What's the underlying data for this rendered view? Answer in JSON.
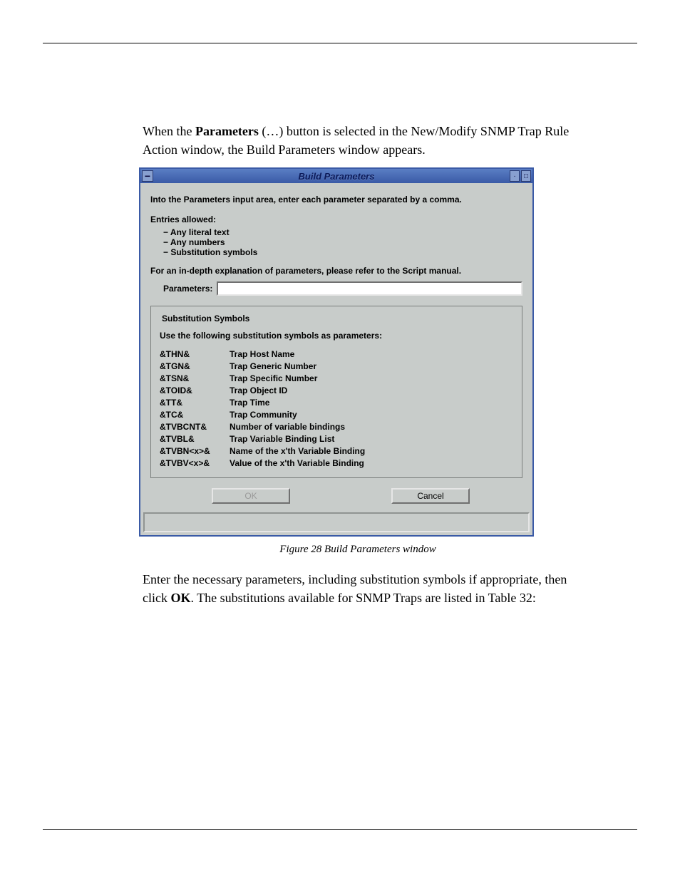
{
  "intro": {
    "prefix": "When the ",
    "boldWord": "Parameters",
    "suffix": " (…) button is selected in the New/Modify SNMP Trap Rule Action window, the Build Parameters window appears."
  },
  "window": {
    "title": "Build Parameters",
    "instruction": "Into the Parameters input area, enter each parameter separated by a comma.",
    "allowedHeader": "Entries allowed:",
    "allowed": [
      "Any literal text",
      "Any numbers",
      "Substitution symbols"
    ],
    "refText": "For an in-depth explanation of parameters, please refer to the Script manual.",
    "paramLabel": "Parameters:",
    "paramValue": "",
    "substitution": {
      "title": "Substitution Symbols",
      "intro": "Use the following substitution symbols as parameters:",
      "rows": [
        {
          "sym": "&THN&",
          "desc": "Trap Host Name"
        },
        {
          "sym": "&TGN&",
          "desc": "Trap Generic Number"
        },
        {
          "sym": "&TSN&",
          "desc": "Trap Specific Number"
        },
        {
          "sym": "&TOID&",
          "desc": "Trap Object ID"
        },
        {
          "sym": "&TT&",
          "desc": "Trap Time"
        },
        {
          "sym": "&TC&",
          "desc": "Trap Community"
        },
        {
          "sym": "&TVBCNT&",
          "desc": "Number of variable bindings"
        },
        {
          "sym": "&TVBL&",
          "desc": "Trap Variable Binding List"
        },
        {
          "sym": "&TVBN<x>&",
          "desc": "Name of the x'th Variable Binding"
        },
        {
          "sym": "&TVBV<x>&",
          "desc": "Value of the x'th Variable Binding"
        }
      ]
    },
    "buttons": {
      "ok": "OK",
      "cancel": "Cancel"
    }
  },
  "caption": "Figure 28 Build Parameters window",
  "outro": {
    "prefix": "Enter the necessary parameters, including substitution symbols if appropriate, then click ",
    "boldWord": "OK",
    "suffix": ". The substitutions available for SNMP Traps are listed in Table 32:"
  }
}
